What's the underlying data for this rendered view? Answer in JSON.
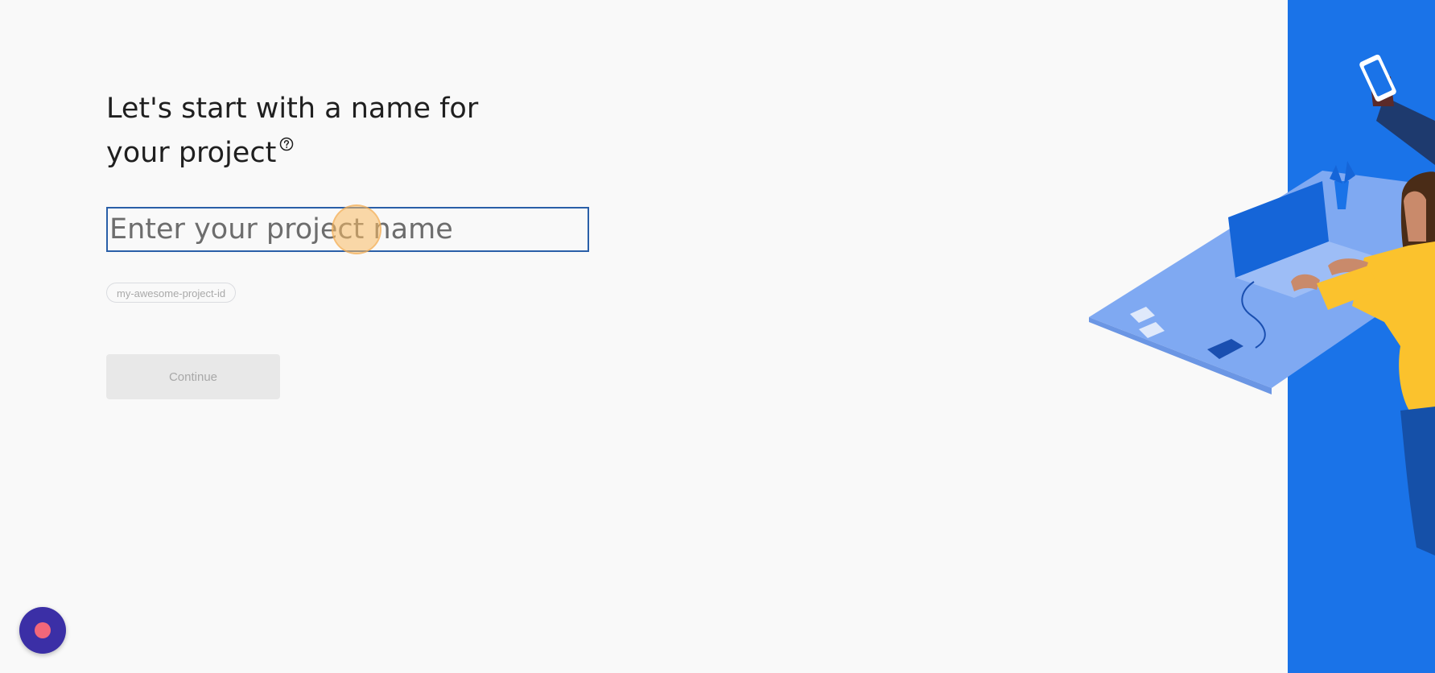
{
  "heading": {
    "line1": "Let's start with a name for",
    "line2": "your project"
  },
  "help_icon": "help-circle-icon",
  "project_name_input": {
    "value": "",
    "placeholder": "Enter your project name"
  },
  "project_id_chip": {
    "text": "my-awesome-project-id"
  },
  "continue_button": {
    "label": "Continue",
    "disabled": true
  },
  "fab": {
    "icon": "record-dot-icon"
  },
  "colors": {
    "page_background": "#f9f9f9",
    "heading_text": "#1f1f1f",
    "input_border": "#2a5fa8",
    "panel_blue": "#1a73e8",
    "button_disabled_bg": "#e8e8e8",
    "fab_background": "#3b2fa6",
    "fab_dot": "#f2677a"
  }
}
